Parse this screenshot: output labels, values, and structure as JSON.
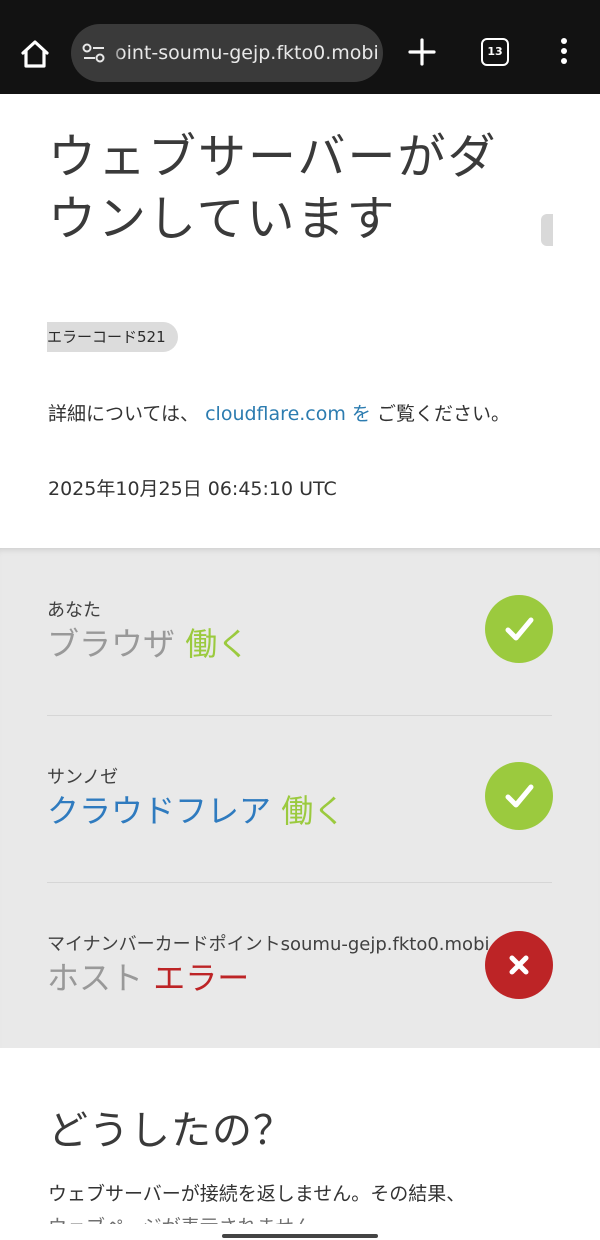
{
  "browser": {
    "url": "oint-soumu-gejp.fkto0.mobi",
    "tab_count": "13"
  },
  "page": {
    "title": "ウェブサーバーがダウンしています",
    "error_code": "エラーコード521",
    "detail_prefix": "詳細については、",
    "detail_link": "cloudflare.com を",
    "detail_suffix": "ご覧ください。",
    "timestamp": "2025年10月25日 06:45:10 UTC"
  },
  "status": [
    {
      "location": "あなた",
      "name": "ブラウザ",
      "state": "働く",
      "result": "ok"
    },
    {
      "location": "サンノゼ",
      "name": "クラウドフレア",
      "state": "働く",
      "result": "ok"
    },
    {
      "location": "マイナンバーカードポイントsoumu-gejp.fkto0.mobi",
      "name": "ホスト",
      "state": "エラー",
      "result": "error"
    }
  ],
  "section": {
    "title": "どうしたの？",
    "text": "ウェブサーバーが接続を返しません。その結果、",
    "text2": "ウェブページが表示されません。"
  },
  "colors": {
    "ok": "#9bca3e",
    "error": "#bd2426",
    "link": "#2c7cb0"
  }
}
